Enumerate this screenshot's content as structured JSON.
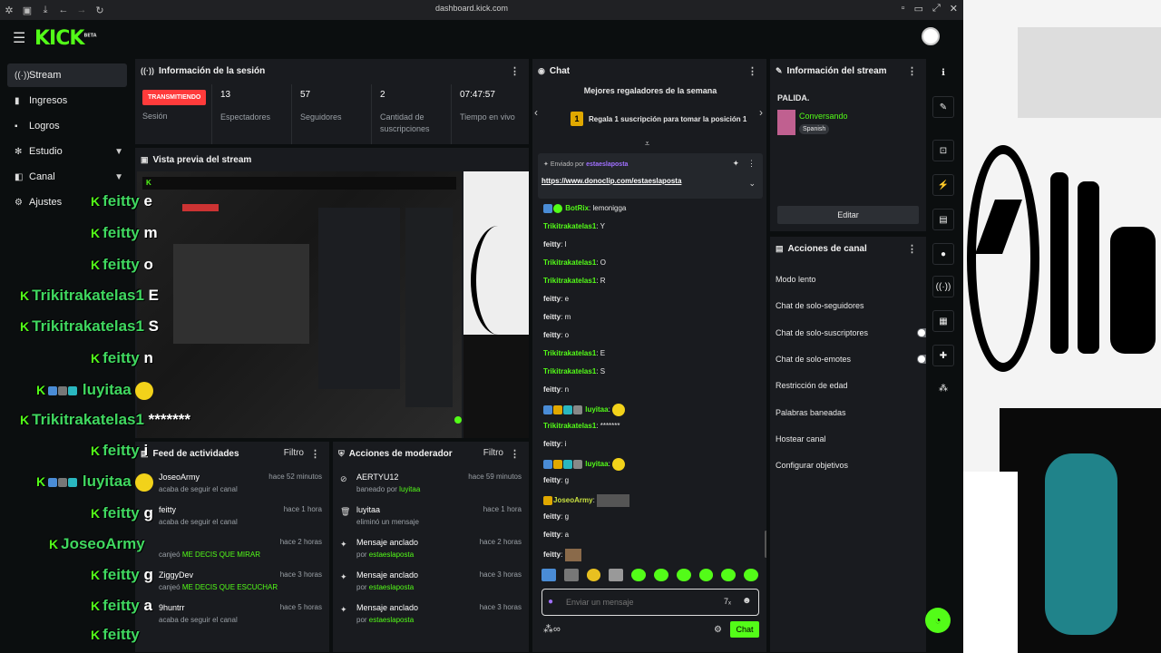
{
  "browser": {
    "url": "dashboard.kick.com"
  },
  "header": {
    "logo": "KICK",
    "logo_sup": "BETA"
  },
  "sidebar": {
    "items": [
      {
        "label": "Stream",
        "icon": "signal-icon"
      },
      {
        "label": "Ingresos",
        "icon": "chart-icon"
      },
      {
        "label": "Logros",
        "icon": "trophy-icon"
      },
      {
        "label": "Estudio",
        "icon": "settings-icon"
      },
      {
        "label": "Canal",
        "icon": "channel-icon"
      },
      {
        "label": "Ajustes",
        "icon": "gear-icon"
      }
    ]
  },
  "session": {
    "title": "Información de la sesión",
    "live_label": "TRANSMITIENDO",
    "live_sub": "Sesión",
    "stats": [
      {
        "value": "13",
        "label": "Espectadores"
      },
      {
        "value": "57",
        "label": "Seguidores"
      },
      {
        "value": "2",
        "label": "Cantidad de suscripciones"
      },
      {
        "value": "07:47:57",
        "label": "Tiempo en vivo"
      }
    ]
  },
  "preview": {
    "title": "Vista previa del stream"
  },
  "overlay_chat": [
    {
      "user": "feitty",
      "msg": "e"
    },
    {
      "user": "feitty",
      "msg": "m"
    },
    {
      "user": "feitty",
      "msg": "o"
    },
    {
      "user": "Trikitrakatelas1",
      "msg": "E"
    },
    {
      "user": "Trikitrakatelas1",
      "msg": "S"
    },
    {
      "user": "feitty",
      "msg": "n"
    },
    {
      "user": "luyitaa",
      "msg": ""
    },
    {
      "user": "Trikitrakatelas1",
      "msg": "*******"
    },
    {
      "user": "feitty",
      "msg": "i"
    },
    {
      "user": "luyitaa",
      "msg": ""
    },
    {
      "user": "feitty",
      "msg": "g"
    },
    {
      "user": "JoseoArmy",
      "msg": ""
    },
    {
      "user": "feitty",
      "msg": "g"
    },
    {
      "user": "feitty",
      "msg": "a"
    },
    {
      "user": "feitty",
      "msg": ""
    }
  ],
  "feed": {
    "title": "Feed de actividades",
    "filter": "Filtro",
    "rows": [
      {
        "name": "JoseoArmy",
        "sub": "acaba de seguir el canal",
        "sub_highlight": "",
        "time": "hace 52 minutos"
      },
      {
        "name": "feitty",
        "sub": "acaba de seguir el canal",
        "sub_highlight": "",
        "time": "hace 1 hora"
      },
      {
        "name": "",
        "sub": "canjeó",
        "sub_highlight": "ME DECIS QUE MIRAR",
        "time": "hace 2 horas"
      },
      {
        "name": "ZiggyDev",
        "sub": "canjeó",
        "sub_highlight": "ME DECIS QUE ESCUCHAR",
        "time": "hace 3 horas"
      },
      {
        "name": "9huntrr",
        "sub": "acaba de seguir el canal",
        "sub_highlight": "",
        "time": "hace 5 horas"
      }
    ]
  },
  "mod": {
    "title": "Acciones de moderador",
    "filter": "Filtro",
    "rows": [
      {
        "name": "AERTYU12",
        "sub": "baneado por",
        "sub_highlight": "luyitaa",
        "time": "hace 59 minutos",
        "icon": "ban-icon"
      },
      {
        "name": "luyitaa",
        "sub": "eliminó un mensaje",
        "sub_highlight": "",
        "time": "hace 1 hora",
        "icon": "trash-icon"
      },
      {
        "name": "Mensaje anclado",
        "sub": "por",
        "sub_highlight": "estaeslaposta",
        "time": "hace 2 horas",
        "icon": "pin-icon"
      },
      {
        "name": "Mensaje anclado",
        "sub": "por",
        "sub_highlight": "estaeslaposta",
        "time": "hace 3 horas",
        "icon": "pin-icon"
      },
      {
        "name": "Mensaje anclado",
        "sub": "por",
        "sub_highlight": "estaeslaposta",
        "time": "hace 3 horas",
        "icon": "pin-icon"
      }
    ]
  },
  "chat": {
    "title": "Chat",
    "gifter_title": "Mejores regaladores de la semana",
    "gifter_rank": "1",
    "gifter_text": "Regala 1 suscripción para tomar la posición 1",
    "pinned_by_label": "Enviado por",
    "pinned_by_user": "estaeslaposta",
    "pinned_link": "https://www.donoclip.com/estaeslaposta",
    "messages": [
      {
        "user": "BotRix",
        "msg": "lemonigga",
        "color": "green"
      },
      {
        "user": "Trikitrakatelas1",
        "msg": "Y",
        "color": "green"
      },
      {
        "user": "feitty",
        "msg": "l",
        "color": "white"
      },
      {
        "user": "Trikitrakatelas1",
        "msg": "O",
        "color": "green"
      },
      {
        "user": "Trikitrakatelas1",
        "msg": "R",
        "color": "green"
      },
      {
        "user": "feitty",
        "msg": "e",
        "color": "white"
      },
      {
        "user": "feitty",
        "msg": "m",
        "color": "white"
      },
      {
        "user": "feitty",
        "msg": "o",
        "color": "white"
      },
      {
        "user": "Trikitrakatelas1",
        "msg": "E",
        "color": "green"
      },
      {
        "user": "Trikitrakatelas1",
        "msg": "S",
        "color": "green"
      },
      {
        "user": "feitty",
        "msg": "n",
        "color": "white"
      },
      {
        "user": "luyitaa",
        "msg": "",
        "color": "green"
      },
      {
        "user": "Trikitrakatelas1",
        "msg": "*******",
        "color": "green"
      },
      {
        "user": "feitty",
        "msg": "i",
        "color": "white"
      },
      {
        "user": "luyitaa",
        "msg": "",
        "color": "green"
      },
      {
        "user": "feitty",
        "msg": "g",
        "color": "white"
      },
      {
        "user": "JoseoArmy",
        "msg": "",
        "color": "yellow"
      },
      {
        "user": "feitty",
        "msg": "g",
        "color": "white"
      },
      {
        "user": "feitty",
        "msg": "a",
        "color": "white"
      },
      {
        "user": "feitty",
        "msg": "",
        "color": "white"
      }
    ],
    "input_placeholder": "Enviar un mensaje",
    "send_label": "Chat"
  },
  "stream_info": {
    "title": "Información del stream",
    "stream_title": "PALIDA.",
    "category": "Conversando",
    "language": "Spanish",
    "edit_label": "Editar"
  },
  "channel_actions": {
    "title": "Acciones de canal",
    "items": [
      {
        "label": "Modo lento",
        "control": "arrow"
      },
      {
        "label": "Chat de solo-seguidores",
        "control": "arrow"
      },
      {
        "label": "Chat de solo-suscriptores",
        "control": "toggle"
      },
      {
        "label": "Chat de solo-emotes",
        "control": "toggle"
      },
      {
        "label": "Restricción de edad",
        "control": "arrow"
      },
      {
        "label": "Palabras baneadas",
        "control": "arrow"
      },
      {
        "label": "Hostear canal",
        "control": "none"
      },
      {
        "label": "Configurar objetivos",
        "control": "arrow"
      }
    ]
  },
  "colors": {
    "brand": "#53fc18",
    "live": "#ff3b3b",
    "panel": "#191b1f",
    "bg": "#0b0e0f"
  }
}
